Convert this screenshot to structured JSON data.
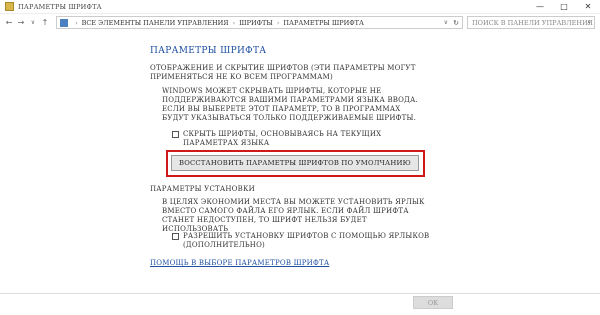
{
  "window": {
    "title": "ПАРАМЕТРЫ ШРИФТА",
    "minimize": "—",
    "maximize": "□",
    "close": "✕"
  },
  "address": {
    "path": [
      "ВСЕ ЭЛЕМЕНТЫ ПАНЕЛИ УПРАВЛЕНИЯ",
      "ШРИФТЫ",
      "ПАРАМЕТРЫ ШРИФТА"
    ],
    "search_placeholder": "ПОИСК В ПАНЕЛИ УПРАВЛЕНИЯ"
  },
  "content": {
    "heading": "ПАРАМЕТРЫ ШРИФТА",
    "section1_title": "ОТОБРАЖЕНИЕ И СКРЫТИЕ ШРИФТОВ (ЭТИ ПАРАМЕТРЫ МОГУТ ПРИМЕНЯТЬСЯ НЕ КО ВСЕМ ПРОГРАММАМ)",
    "section1_desc": "WINDOWS МОЖЕТ СКРЫВАТЬ ШРИФТЫ, КОТОРЫЕ НЕ ПОДДЕРЖИВАЮТСЯ ВАШИМИ ПАРАМЕТРАМИ ЯЗЫКА ВВОДА. ЕСЛИ ВЫ ВЫБЕРЕТЕ ЭТОТ ПАРАМЕТР, ТО В ПРОГРАММАХ БУДУТ УКАЗЫВАТЬСЯ ТОЛЬКО ПОДДЕРЖИВАЕМЫЕ ШРИФТЫ.",
    "hide_fonts_label": "СКРЫТЬ ШРИФТЫ, ОСНОВЫВАЯСЬ НА ТЕКУЩИХ ПАРАМЕТРАХ ЯЗЫКА",
    "restore_button": "ВОССТАНОВИТЬ ПАРАМЕТРЫ ШРИФТОВ ПО УМОЛЧАНИЮ",
    "section2_title": "ПАРАМЕТРЫ УСТАНОВКИ",
    "section2_desc": "В ЦЕЛЯХ ЭКОНОМИИ МЕСТА ВЫ МОЖЕТЕ УСТАНОВИТЬ ЯРЛЫК ВМЕСТО САМОГО ФАЙЛА ЕГО ЯРЛЫК. ЕСЛИ ФАЙЛ ШРИФТА СТАНЕТ НЕДОСТУПЕН, ТО ШРИФТ НЕЛЬЗЯ БУДЕТ ИСПОЛЬЗОВАТЬ",
    "allow_shortcuts_label": "РАЗРЕШИТЬ УСТАНОВКУ ШРИФТОВ С ПОМОЩЬЮ ЯРЛЫКОВ (ДОПОЛНИТЕЛЬНО)",
    "help_link": "ПОМОЩЬ В ВЫБОРЕ ПАРАМЕТРОВ ШРИФТА",
    "ok_button": "ОК"
  }
}
